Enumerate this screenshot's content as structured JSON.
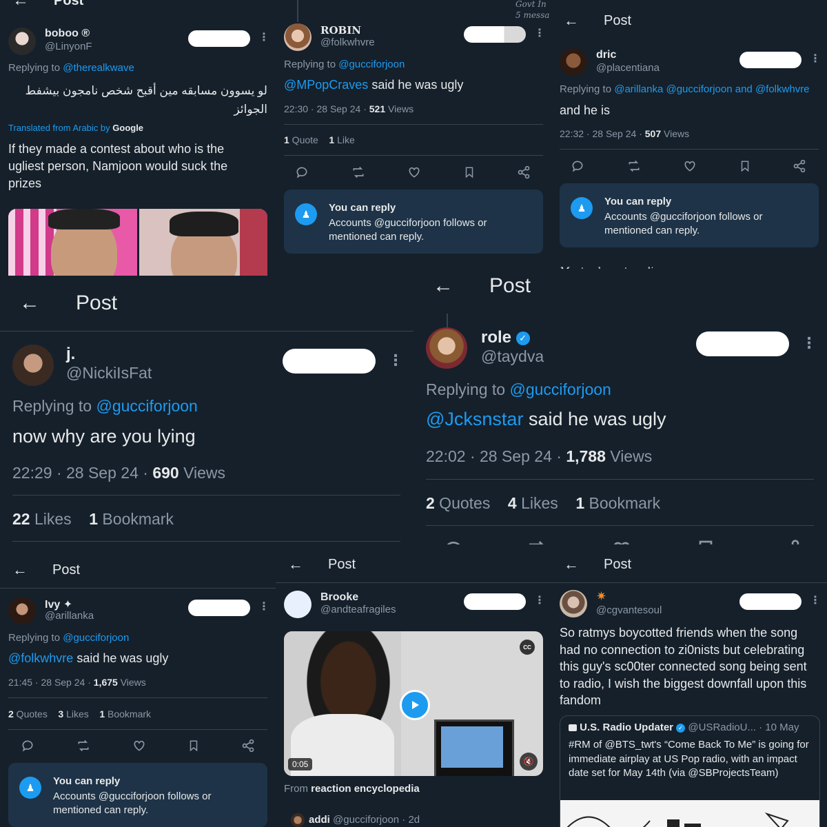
{
  "common": {
    "post_title": "Post",
    "you_can_reply": "You can reply",
    "reply_restriction": "Accounts @gucciforjoon follows or mentioned can reply.",
    "replying_to": "Replying to"
  },
  "p1": {
    "name": "boboo ®",
    "handle": "@LinyonF",
    "replying_handle": "@therealkwave",
    "arabic": "لو يسوون مسابقه مين أقبح شخص نامجون بيشفط الجوائز",
    "translated_from": "Translated from Arabic by",
    "translator": "Google",
    "translation": "If they made a contest about who is the ugliest person, Namjoon would suck the prizes"
  },
  "p2": {
    "name": "ROBIN",
    "handle": "@folkwhvre",
    "replying_handle": "@gucciforjoon",
    "mention": "@MPopCraves",
    "text": " said he was ugly",
    "meta": "22:30 · 28 Sep 24 · ",
    "views": "521",
    "views_label": " Views",
    "quotes": "1",
    "quotes_label": " Quote",
    "likes": "1",
    "likes_label": " Like",
    "bg_note1": "Govt In",
    "bg_note2": "5 messa"
  },
  "p3": {
    "name": "dric",
    "handle": "@placentiana",
    "replying_handles": "@arillanka @gucciforjoon and @folkwhvre",
    "text": "and he is",
    "meta": "22:32 · 28 Sep 24 · ",
    "views": "507",
    "views_label": " Views",
    "most_relevant": "Most relevant replies"
  },
  "p4": {
    "name": "j.",
    "handle": "@NickiIsFat",
    "replying_handle": "@gucciforjoon",
    "text": "now why are you lying",
    "meta": "22:29 · 28 Sep 24 · ",
    "views": "690",
    "views_label": " Views",
    "likes": "22",
    "likes_label": " Likes",
    "bookmarks": "1",
    "bookmarks_label": " Bookmark"
  },
  "p5": {
    "name": "role",
    "handle": "@taydva",
    "replying_handle": "@gucciforjoon",
    "mention": "@Jcksnstar",
    "text": " said he was ugly",
    "meta": "22:02 · 28 Sep 24 · ",
    "views": "1,788",
    "views_label": " Views",
    "quotes": "2",
    "quotes_label": " Quotes",
    "likes": "4",
    "likes_label": " Likes",
    "bookmarks": "1",
    "bookmarks_label": " Bookmark"
  },
  "p6": {
    "name": "Ivy ✦",
    "handle": "@arillanka",
    "replying_handle": "@gucciforjoon",
    "mention": "@folkwhvre",
    "text": " said he was ugly",
    "meta": "21:45 · 28 Sep 24 · ",
    "views": "1,675",
    "views_label": " Views",
    "quotes": "2",
    "quotes_label": " Quotes",
    "likes": "3",
    "likes_label": " Likes",
    "bookmarks": "1",
    "bookmarks_label": " Bookmark"
  },
  "p7": {
    "name": "Brooke",
    "handle": "@andteafragiles",
    "duration": "0:05",
    "from_label": "From ",
    "from_source": "reaction encyclopedia",
    "next_name": "addi",
    "next_handle": "@gucciforjoon · 2d",
    "cc": "CC"
  },
  "p8": {
    "name": "✷",
    "handle": "@cgvantesoul",
    "text": "So ratmys boycotted friends when the song had no connection to zi0nists but celebrating this guy's sc00ter connected song being sent to radio, I wish the biggest downfall upon this fandom",
    "quote_name": "U.S. Radio Updater",
    "quote_handle": "@USRadioU...",
    "quote_time": "· 10 May",
    "quote_text": "#RM of @BTS_twt's “Come Back To Me” is going for immediate airplay at US Pop radio, with an impact date set for May 14th (via @SBProjectsTeam)"
  },
  "colors": {
    "background": "#15202b",
    "accent": "#1d9bf0",
    "muted": "#8b98a5",
    "reply_box": "#1e3347"
  },
  "icons": [
    "back-arrow-icon",
    "more-icon",
    "reply-icon",
    "retweet-icon",
    "like-icon",
    "bookmark-icon",
    "share-icon",
    "reply-permission-icon",
    "verified-icon",
    "play-icon",
    "mute-icon",
    "cc-icon",
    "chevron-down-icon"
  ]
}
